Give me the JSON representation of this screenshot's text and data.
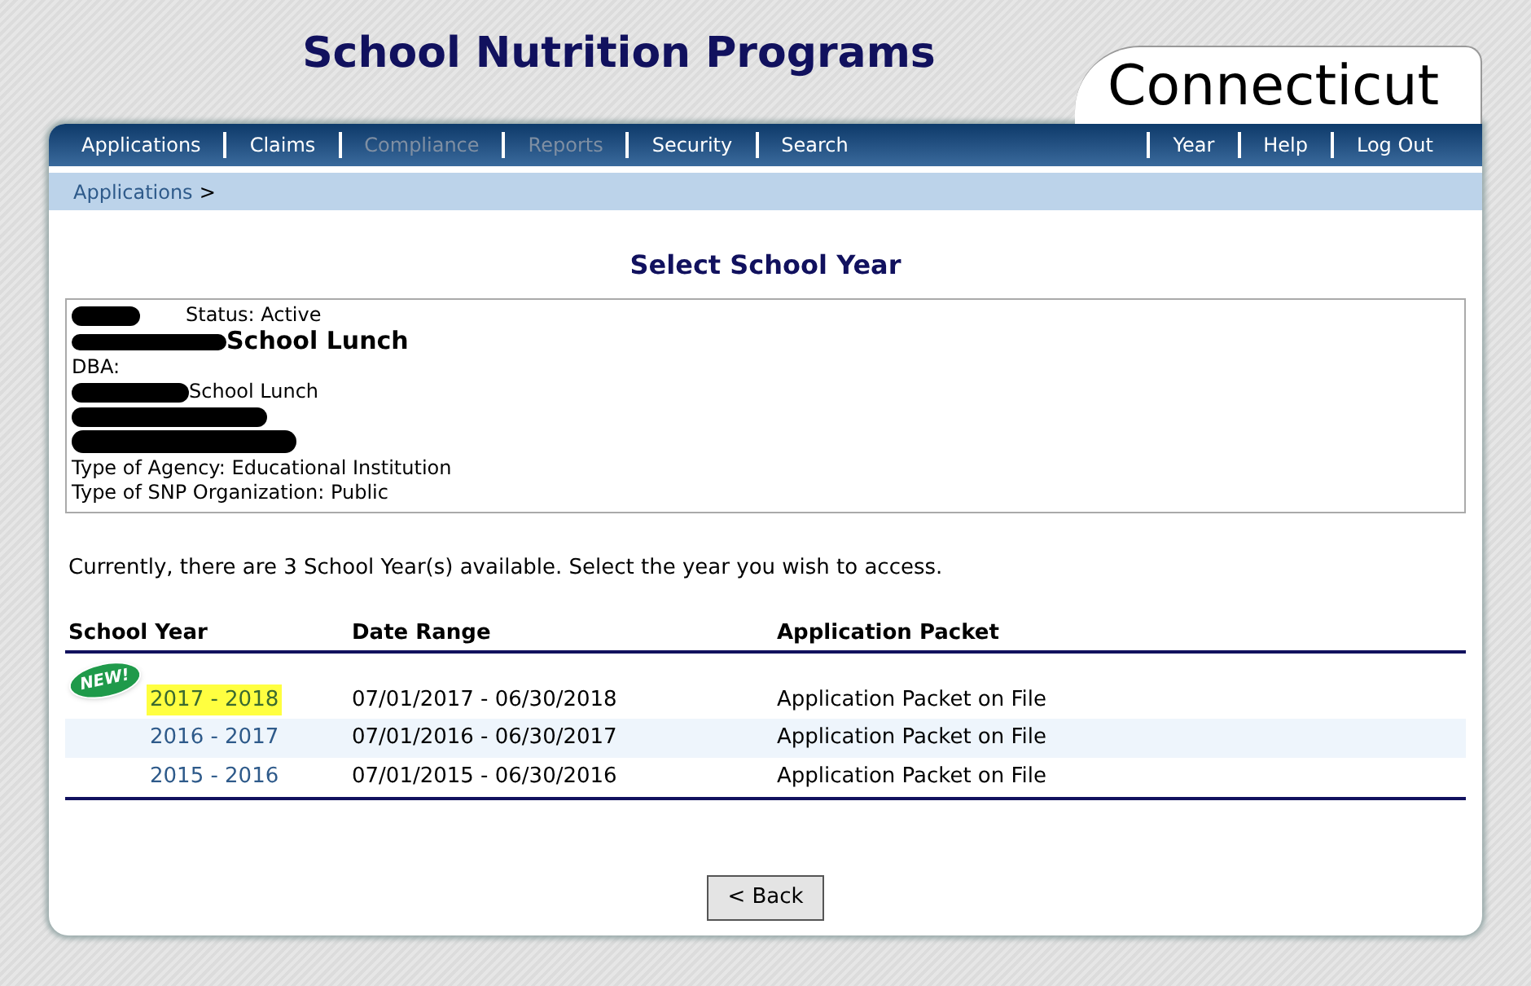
{
  "header": {
    "title": "School Nutrition Programs",
    "state": "Connecticut"
  },
  "nav": {
    "left": [
      {
        "label": "Applications",
        "disabled": false
      },
      {
        "label": "Claims",
        "disabled": false
      },
      {
        "label": "Compliance",
        "disabled": true
      },
      {
        "label": "Reports",
        "disabled": true
      },
      {
        "label": "Security",
        "disabled": false
      },
      {
        "label": "Search",
        "disabled": false
      }
    ],
    "right": [
      {
        "label": "Year",
        "disabled": false
      },
      {
        "label": "Help",
        "disabled": false
      },
      {
        "label": "Log Out",
        "disabled": false
      }
    ]
  },
  "breadcrumb": {
    "link": "Applications",
    "separator": ">"
  },
  "heading": "Select School Year",
  "sponsor": {
    "status": "Status: Active",
    "name": "School Lunch",
    "dba_label": "DBA:",
    "dba": "School Lunch",
    "agency_type": "Type of Agency: Educational Institution",
    "organization_type": "Type of SNP Organization: Public"
  },
  "message": "Currently, there are 3 School Year(s) available. Select the year you wish to access.",
  "table": {
    "columns": [
      "School Year",
      "Date Range",
      "Application Packet"
    ],
    "rows": [
      {
        "year": "2017 - 2018",
        "range": "07/01/2017 - 06/30/2018",
        "packet": "Application Packet on File",
        "new_badge": "NEW!",
        "highlighted": true
      },
      {
        "year": "2016 - 2017",
        "range": "07/01/2016 - 06/30/2017",
        "packet": "Application Packet on File",
        "highlighted": false
      },
      {
        "year": "2015 - 2016",
        "range": "07/01/2015 - 06/30/2016",
        "packet": "Application Packet on File",
        "highlighted": false
      }
    ]
  },
  "back_button": "< Back"
}
